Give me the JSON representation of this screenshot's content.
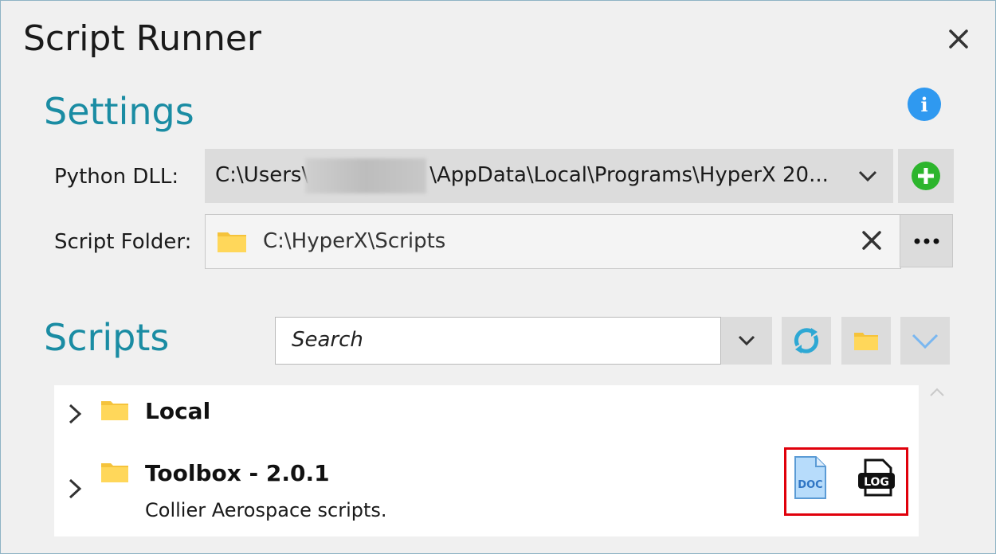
{
  "window": {
    "title": "Script Runner"
  },
  "settings": {
    "heading": "Settings",
    "python_dll": {
      "label": "Python DLL:",
      "value_prefix": "C:\\Users\\",
      "value_suffix": "\\AppData\\Local\\Programs\\HyperX 20..."
    },
    "script_folder": {
      "label": "Script Folder:",
      "value": "C:\\HyperX\\Scripts"
    }
  },
  "scripts": {
    "heading": "Scripts",
    "search_placeholder": "Search",
    "tree": [
      {
        "name": "Local",
        "description": ""
      },
      {
        "name": "Toolbox - 2.0.1",
        "description": "Collier Aerospace scripts.",
        "actions": [
          "DOC",
          "LOG"
        ]
      }
    ]
  },
  "colors": {
    "accent": "#1a8ca3",
    "info": "#2f99f0",
    "add": "#2db52d",
    "highlight": "#e0000b"
  },
  "icons": [
    "close-icon",
    "info-icon",
    "chevron-down-icon",
    "add-icon",
    "folder-icon",
    "clear-icon",
    "more-icon",
    "refresh-icon",
    "expand-icon",
    "chevron-right-icon",
    "doc-icon",
    "log-icon",
    "scroll-up-icon"
  ]
}
